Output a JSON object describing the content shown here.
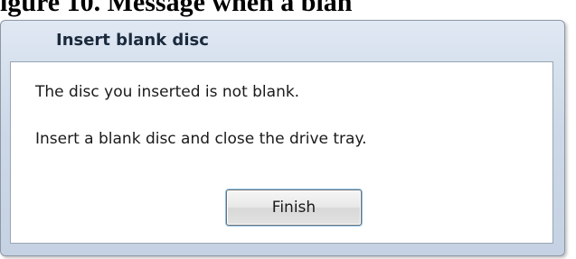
{
  "figure": {
    "caption": "igure 10. Message when a blan"
  },
  "dialog": {
    "title": "Insert blank disc",
    "messages": [
      "The disc you inserted is not blank.",
      "Insert a blank disc and close the drive tray."
    ],
    "buttons": {
      "finish_label": "Finish"
    }
  }
}
